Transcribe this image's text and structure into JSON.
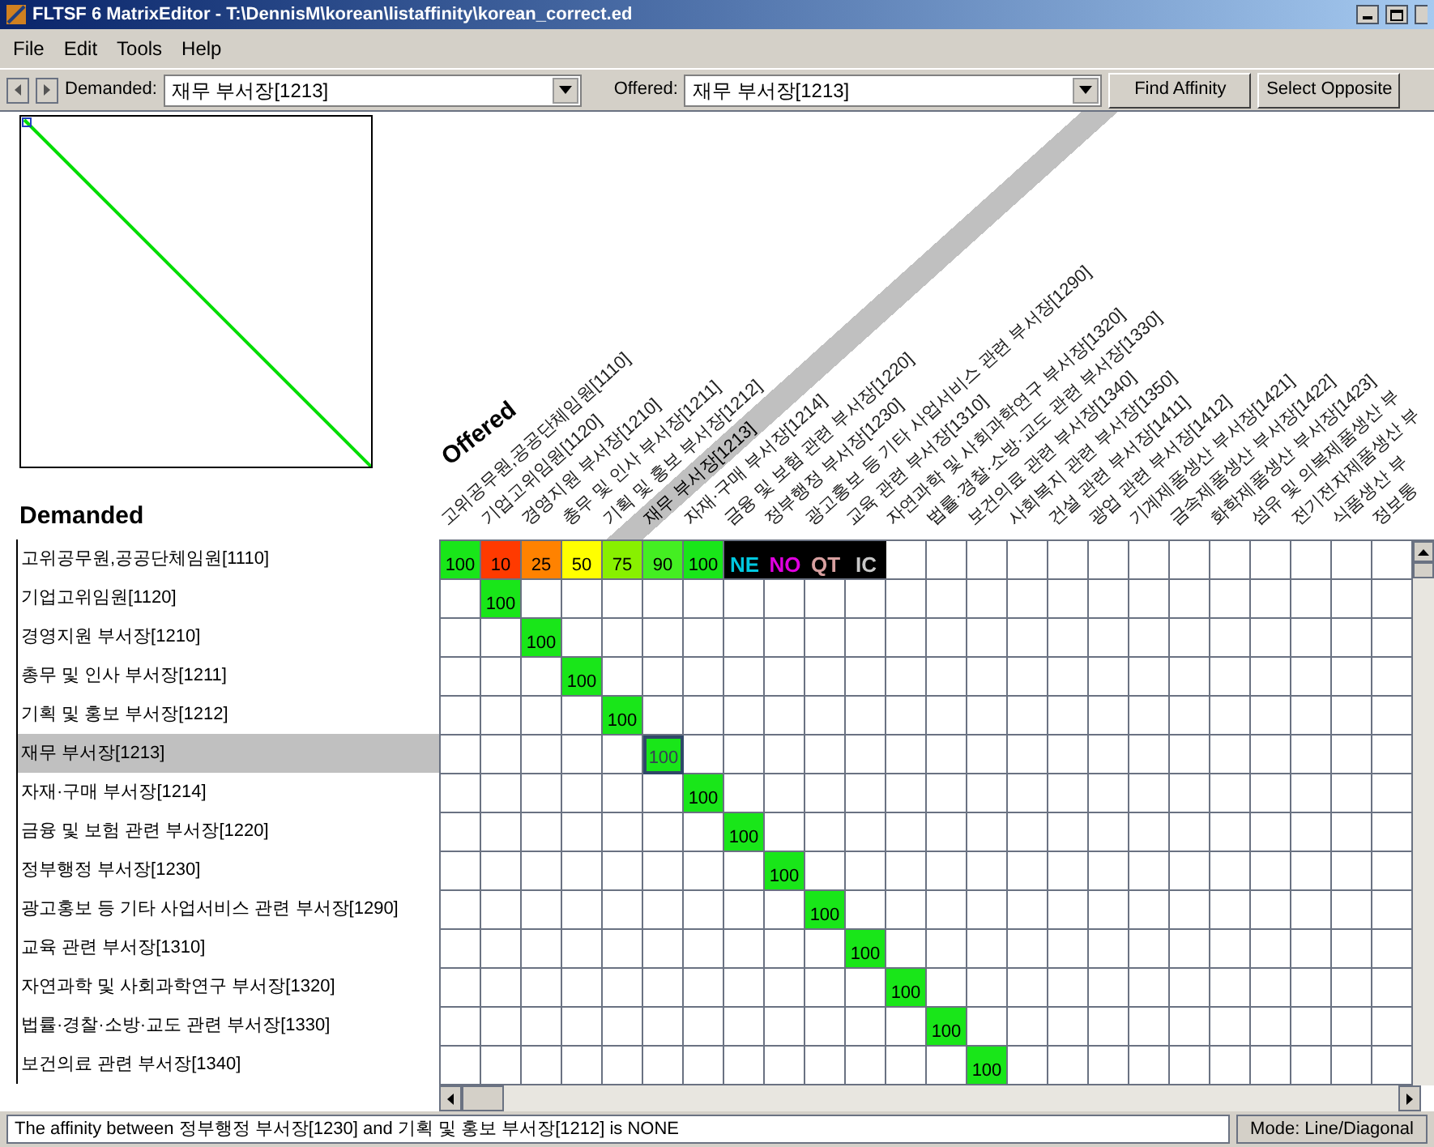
{
  "window": {
    "title": "FLTSF 6 MatrixEditor - T:\\DennisM\\korean\\listaffinity\\korean_correct.ed"
  },
  "menu": [
    "File",
    "Edit",
    "Tools",
    "Help"
  ],
  "toolbar": {
    "demanded_label": "Demanded:",
    "demanded_value": "재무 부서장[1213]",
    "offered_label": "Offered:",
    "offered_value": "재무 부서장[1213]",
    "buttons": [
      "Find Affinity",
      "Select Opposite"
    ]
  },
  "matrix": {
    "offered_title": "Offered",
    "demanded_title": "Demanded",
    "columns": [
      {
        "label": "고위공무원,공공단체임원[1110]",
        "selected": false
      },
      {
        "label": "기업고위임원[1120]",
        "selected": false
      },
      {
        "label": "경영지원 부서장[1210]",
        "selected": false
      },
      {
        "label": "총무 및 인사 부서장[1211]",
        "selected": false
      },
      {
        "label": "기획 및 홍보 부서장[1212]",
        "selected": false
      },
      {
        "label": "재무 부서장[1213]",
        "selected": true
      },
      {
        "label": "자재·구매 부서장[1214]",
        "selected": false
      },
      {
        "label": "금융 및 보험 관련 부서장[1220]",
        "selected": false
      },
      {
        "label": "정부행정 부서장[1230]",
        "selected": false
      },
      {
        "label": "광고홍보 등 기타 사업서비스 관련 부서장[1290]",
        "selected": false
      },
      {
        "label": "교육 관련 부서장[1310]",
        "selected": false
      },
      {
        "label": "자연과학 및 사회과학연구 부서장[1320]",
        "selected": false
      },
      {
        "label": "법률·경찰·소방·교도 관련 부서장[1330]",
        "selected": false
      },
      {
        "label": "보건의료 관련 부서장[1340]",
        "selected": false
      },
      {
        "label": "사회복지 관련 부서장[1350]",
        "selected": false
      },
      {
        "label": "건설 관련 부서장[1411]",
        "selected": false
      },
      {
        "label": "광업 관련 부서장[1412]",
        "selected": false
      },
      {
        "label": "기계제품생산 부서장[1421]",
        "selected": false
      },
      {
        "label": "금속제품생산 부서장[1422]",
        "selected": false
      },
      {
        "label": "화학제품생산 부서장[1423]",
        "selected": false
      },
      {
        "label": "섬유 및 의복제품생산 부",
        "selected": false
      },
      {
        "label": "전기전자제품생산 부",
        "selected": false
      },
      {
        "label": "식품생산 부",
        "selected": false
      },
      {
        "label": "정보통",
        "selected": false
      }
    ],
    "rows": [
      {
        "label": "고위공무원,공공단체임원[1110]",
        "selected": false,
        "cells": [
          {
            "kind": "score",
            "value": "100",
            "color": "#19e619"
          },
          {
            "kind": "score",
            "value": "10",
            "color": "#ff3a00"
          },
          {
            "kind": "score",
            "value": "25",
            "color": "#ff8200"
          },
          {
            "kind": "score",
            "value": "50",
            "color": "#ffff00"
          },
          {
            "kind": "score",
            "value": "75",
            "color": "#88f000"
          },
          {
            "kind": "score",
            "value": "90",
            "color": "#44ee22"
          },
          {
            "kind": "score",
            "value": "100",
            "color": "#19e619"
          },
          {
            "kind": "code",
            "value": "NE",
            "color": "#00c8e0"
          },
          {
            "kind": "code",
            "value": "NO",
            "color": "#e000e0"
          },
          {
            "kind": "code",
            "value": "QT",
            "color": "#d8a0a0"
          },
          {
            "kind": "code",
            "value": "IC",
            "color": "#c8c8c8"
          },
          "",
          "",
          "",
          "",
          "",
          "",
          "",
          "",
          "",
          "",
          "",
          "",
          ""
        ]
      },
      {
        "label": "기업고위임원[1120]",
        "selected": false,
        "cells": [
          "",
          {
            "kind": "score",
            "value": "100",
            "color": "#19e619"
          },
          "",
          "",
          "",
          "",
          "",
          "",
          "",
          "",
          "",
          "",
          "",
          "",
          "",
          "",
          "",
          "",
          "",
          "",
          "",
          "",
          "",
          ""
        ]
      },
      {
        "label": "경영지원 부서장[1210]",
        "selected": false,
        "cells": [
          "",
          "",
          {
            "kind": "score",
            "value": "100",
            "color": "#19e619"
          },
          "",
          "",
          "",
          "",
          "",
          "",
          "",
          "",
          "",
          "",
          "",
          "",
          "",
          "",
          "",
          "",
          "",
          "",
          "",
          "",
          ""
        ]
      },
      {
        "label": "총무 및 인사 부서장[1211]",
        "selected": false,
        "cells": [
          "",
          "",
          "",
          {
            "kind": "score",
            "value": "100",
            "color": "#19e619"
          },
          "",
          "",
          "",
          "",
          "",
          "",
          "",
          "",
          "",
          "",
          "",
          "",
          "",
          "",
          "",
          "",
          "",
          "",
          "",
          ""
        ]
      },
      {
        "label": "기획 및 홍보 부서장[1212]",
        "selected": false,
        "cells": [
          "",
          "",
          "",
          "",
          {
            "kind": "score",
            "value": "100",
            "color": "#19e619"
          },
          "",
          "",
          "",
          "",
          "",
          "",
          "",
          "",
          "",
          "",
          "",
          "",
          "",
          "",
          "",
          "",
          "",
          "",
          ""
        ]
      },
      {
        "label": "재무 부서장[1213]",
        "selected": true,
        "cells": [
          "",
          "",
          "",
          "",
          "",
          {
            "kind": "score",
            "value": "100",
            "color": "#19e619"
          },
          "",
          "",
          "",
          "",
          "",
          "",
          "",
          "",
          "",
          "",
          "",
          "",
          "",
          "",
          "",
          "",
          "",
          ""
        ]
      },
      {
        "label": "자재·구매 부서장[1214]",
        "selected": false,
        "cells": [
          "",
          "",
          "",
          "",
          "",
          "",
          {
            "kind": "score",
            "value": "100",
            "color": "#19e619"
          },
          "",
          "",
          "",
          "",
          "",
          "",
          "",
          "",
          "",
          "",
          "",
          "",
          "",
          "",
          "",
          "",
          ""
        ]
      },
      {
        "label": "금융 및 보험 관련 부서장[1220]",
        "selected": false,
        "cells": [
          "",
          "",
          "",
          "",
          "",
          "",
          "",
          {
            "kind": "score",
            "value": "100",
            "color": "#19e619"
          },
          "",
          "",
          "",
          "",
          "",
          "",
          "",
          "",
          "",
          "",
          "",
          "",
          "",
          "",
          "",
          ""
        ]
      },
      {
        "label": "정부행정 부서장[1230]",
        "selected": false,
        "cells": [
          "",
          "",
          "",
          "",
          "",
          "",
          "",
          "",
          {
            "kind": "score",
            "value": "100",
            "color": "#19e619"
          },
          "",
          "",
          "",
          "",
          "",
          "",
          "",
          "",
          "",
          "",
          "",
          "",
          "",
          "",
          ""
        ]
      },
      {
        "label": "광고홍보 등 기타 사업서비스 관련 부서장[1290]",
        "selected": false,
        "cells": [
          "",
          "",
          "",
          "",
          "",
          "",
          "",
          "",
          "",
          {
            "kind": "score",
            "value": "100",
            "color": "#19e619"
          },
          "",
          "",
          "",
          "",
          "",
          "",
          "",
          "",
          "",
          "",
          "",
          "",
          "",
          ""
        ]
      },
      {
        "label": "교육 관련 부서장[1310]",
        "selected": false,
        "cells": [
          "",
          "",
          "",
          "",
          "",
          "",
          "",
          "",
          "",
          "",
          {
            "kind": "score",
            "value": "100",
            "color": "#19e619"
          },
          "",
          "",
          "",
          "",
          "",
          "",
          "",
          "",
          "",
          "",
          "",
          "",
          ""
        ]
      },
      {
        "label": "자연과학 및 사회과학연구 부서장[1320]",
        "selected": false,
        "cells": [
          "",
          "",
          "",
          "",
          "",
          "",
          "",
          "",
          "",
          "",
          "",
          {
            "kind": "score",
            "value": "100",
            "color": "#19e619"
          },
          "",
          "",
          "",
          "",
          "",
          "",
          "",
          "",
          "",
          "",
          "",
          ""
        ]
      },
      {
        "label": "법률·경찰·소방·교도 관련 부서장[1330]",
        "selected": false,
        "cells": [
          "",
          "",
          "",
          "",
          "",
          "",
          "",
          "",
          "",
          "",
          "",
          "",
          {
            "kind": "score",
            "value": "100",
            "color": "#19e619"
          },
          "",
          "",
          "",
          "",
          "",
          "",
          "",
          "",
          "",
          "",
          ""
        ]
      },
      {
        "label": "보건의료 관련 부서장[1340]",
        "selected": false,
        "cells": [
          "",
          "",
          "",
          "",
          "",
          "",
          "",
          "",
          "",
          "",
          "",
          "",
          "",
          {
            "kind": "score",
            "value": "100",
            "color": "#19e619"
          },
          "",
          "",
          "",
          "",
          "",
          "",
          "",
          "",
          "",
          ""
        ]
      }
    ]
  },
  "status_bar": {
    "message": "The affinity between 정부행정 부서장[1230] and 기획 및 홍보 부서장[1212] is NONE",
    "mode": "Mode: Line/Diagonal"
  }
}
